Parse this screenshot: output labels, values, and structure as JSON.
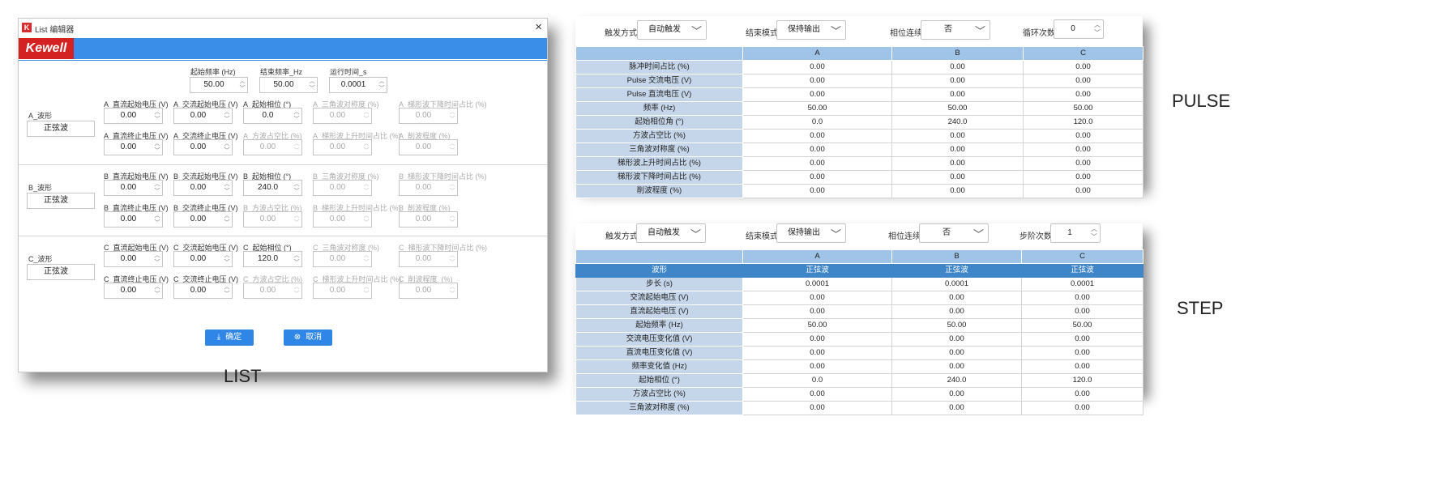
{
  "list_dialog": {
    "window_title": "List 编辑器",
    "logo": "Kewell",
    "close_glyph": "×",
    "top": {
      "start_freq_label": "起始频率 (Hz)",
      "start_freq_value": "50.00",
      "end_freq_label": "结束频率_Hz",
      "end_freq_value": "50.00",
      "run_time_label": "运行时间_s",
      "run_time_value": "0.0001"
    },
    "phases": [
      {
        "waveform_label": "A_波形",
        "waveform_value": "正弦波",
        "dc_start_label": "A_直流起始电压 (V)",
        "dc_start_value": "0.00",
        "ac_start_label": "A_交流起始电压 (V)",
        "ac_start_value": "0.00",
        "start_phase_label": "A_起始相位 (°)",
        "start_phase_value": "0.0",
        "tri_sym_label": "A_三角波对称度 (%)",
        "tri_sym_value": "0.00",
        "trap_fall_label": "A_梯形波下降时间占比 (%)",
        "trap_fall_value": "0.00",
        "dc_end_label": "A_直流终止电压 (V)",
        "dc_end_value": "0.00",
        "ac_end_label": "A_交流终止电压 (V)",
        "ac_end_value": "0.00",
        "square_duty_label": "A_方波占空比 (%)",
        "square_duty_value": "0.00",
        "trap_rise_label": "A_梯形波上升时间占比 (%)",
        "trap_rise_value": "0.00",
        "clip_label": "A_削波程度 (%)",
        "clip_value": "0.00"
      },
      {
        "waveform_label": "B_波形",
        "waveform_value": "正弦波",
        "dc_start_label": "B_直流起始电压 (V)",
        "dc_start_value": "0.00",
        "ac_start_label": "B_交流起始电压 (V)",
        "ac_start_value": "0.00",
        "start_phase_label": "B_起始相位 (°)",
        "start_phase_value": "240.0",
        "tri_sym_label": "B_三角波对称度 (%)",
        "tri_sym_value": "0.00",
        "trap_fall_label": "B_梯形波下降时间占比 (%)",
        "trap_fall_value": "0.00",
        "dc_end_label": "B_直流终止电压 (V)",
        "dc_end_value": "0.00",
        "ac_end_label": "B_交流终止电压 (V)",
        "ac_end_value": "0.00",
        "square_duty_label": "B_方波占空比 (%)",
        "square_duty_value": "0.00",
        "trap_rise_label": "B_梯形波上升时间占比 (%)",
        "trap_rise_value": "0.00",
        "clip_label": "B_削波程度 (%)",
        "clip_value": "0.00"
      },
      {
        "waveform_label": "C_波形",
        "waveform_value": "正弦波",
        "dc_start_label": "C_直流起始电压 (V)",
        "dc_start_value": "0.00",
        "ac_start_label": "C_交流起始电压 (V)",
        "ac_start_value": "0.00",
        "start_phase_label": "C_起始相位 (°)",
        "start_phase_value": "120.0",
        "tri_sym_label": "C_三角波对称度 (%)",
        "tri_sym_value": "0.00",
        "trap_fall_label": "C_梯形波下降时间占比 (%)",
        "trap_fall_value": "0.00",
        "dc_end_label": "C_直流终止电压 (V)",
        "dc_end_value": "0.00",
        "ac_end_label": "C_交流终止电压 (V)",
        "ac_end_value": "0.00",
        "square_duty_label": "C_方波占空比 (%)",
        "square_duty_value": "0.00",
        "trap_rise_label": "C_梯形波上升时间占比 (%)",
        "trap_rise_value": "0.00",
        "clip_label": "C_削波程度_(%)",
        "clip_value": "0.00"
      }
    ],
    "confirm_label": "确定",
    "cancel_label": "取消",
    "caption": "LIST"
  },
  "pulse": {
    "caption": "PULSE",
    "trigger_label": "触发方式",
    "trigger_value": "自动触发",
    "end_mode_label": "结束模式",
    "end_mode_value": "保持输出",
    "phase_cont_label": "相位连续",
    "phase_cont_value": "否",
    "loop_label": "循环次数",
    "loop_value": "0",
    "columns": [
      "A",
      "B",
      "C"
    ],
    "rows": [
      {
        "label": "脉冲时间占比 (%)",
        "values": [
          "0.00",
          "0.00",
          "0.00"
        ]
      },
      {
        "label": "Pulse 交流电压 (V)",
        "values": [
          "0.00",
          "0.00",
          "0.00"
        ]
      },
      {
        "label": "Pulse 直流电压 (V)",
        "values": [
          "0.00",
          "0.00",
          "0.00"
        ]
      },
      {
        "label": "频率 (Hz)",
        "values": [
          "50.00",
          "50.00",
          "50.00"
        ]
      },
      {
        "label": "起始相位角 (°)",
        "values": [
          "0.0",
          "240.0",
          "120.0"
        ]
      },
      {
        "label": "方波占空比 (%)",
        "values": [
          "0.00",
          "0.00",
          "0.00"
        ]
      },
      {
        "label": "三角波对称度 (%)",
        "values": [
          "0.00",
          "0.00",
          "0.00"
        ]
      },
      {
        "label": "梯形波上升时间占比 (%)",
        "values": [
          "0.00",
          "0.00",
          "0.00"
        ]
      },
      {
        "label": "梯形波下降时间占比 (%)",
        "values": [
          "0.00",
          "0.00",
          "0.00"
        ]
      },
      {
        "label": "削波程度 (%)",
        "values": [
          "0.00",
          "0.00",
          "0.00"
        ]
      }
    ]
  },
  "step": {
    "caption": "STEP",
    "trigger_label": "触发方式",
    "trigger_value": "自动触发",
    "end_mode_label": "结束模式",
    "end_mode_value": "保持输出",
    "phase_cont_label": "相位连续",
    "phase_cont_value": "否",
    "steps_label": "步阶次数",
    "steps_value": "1",
    "columns": [
      "A",
      "B",
      "C"
    ],
    "waveform_row": {
      "label": "波形",
      "values": [
        "正弦波",
        "正弦波",
        "正弦波"
      ]
    },
    "rows": [
      {
        "label": "步长 (s)",
        "values": [
          "0.0001",
          "0.0001",
          "0.0001"
        ]
      },
      {
        "label": "交流起始电压 (V)",
        "values": [
          "0.00",
          "0.00",
          "0.00"
        ]
      },
      {
        "label": "直流起始电压 (V)",
        "values": [
          "0.00",
          "0.00",
          "0.00"
        ]
      },
      {
        "label": "起始频率 (Hz)",
        "values": [
          "50.00",
          "50.00",
          "50.00"
        ]
      },
      {
        "label": "交流电压变化值 (V)",
        "values": [
          "0.00",
          "0.00",
          "0.00"
        ]
      },
      {
        "label": "直流电压变化值 (V)",
        "values": [
          "0.00",
          "0.00",
          "0.00"
        ]
      },
      {
        "label": "频率变化值 (Hz)",
        "values": [
          "0.00",
          "0.00",
          "0.00"
        ]
      },
      {
        "label": "起始相位 (°)",
        "values": [
          "0.0",
          "240.0",
          "120.0"
        ]
      },
      {
        "label": "方波占空比 (%)",
        "values": [
          "0.00",
          "0.00",
          "0.00"
        ]
      },
      {
        "label": "三角波对称度 (%)",
        "values": [
          "0.00",
          "0.00",
          "0.00"
        ]
      }
    ]
  }
}
